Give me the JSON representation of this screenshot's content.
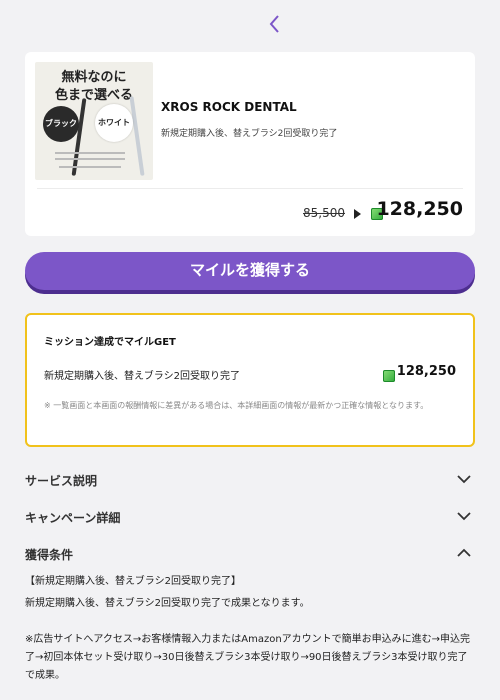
{
  "header": {
    "back_icon": "chevron-left-icon"
  },
  "offer": {
    "thumbnail": {
      "line1": "無料なのに",
      "line2": "色まで選べる",
      "black_label": "ブラック",
      "white_label": "ホワイト"
    },
    "title": "XROS ROCK DENTAL",
    "description": "新規定期購入後、替えブラシ2回受取り完了",
    "old_points": "85,500",
    "points": "128,250"
  },
  "cta": {
    "label": "マイルを獲得する"
  },
  "mission": {
    "title": "ミッション達成でマイルGET",
    "description": "新規定期購入後、替えブラシ2回受取り完了",
    "points": "128,250",
    "note": "※ 一覧画面と本画面の報酬情報に差異がある場合は、本詳細画面の情報が最新かつ正確な情報となります。"
  },
  "sections": [
    {
      "label": "サービス説明",
      "expanded": false
    },
    {
      "label": "キャンペーン詳細",
      "expanded": false
    },
    {
      "label": "獲得条件",
      "expanded": true
    }
  ],
  "conditions": {
    "heading": "【新規定期購入後、替えブラシ2回受取り完了】",
    "line1": "新規定期購入後、替えブラシ2回受取り完了で成果となります。",
    "line2": "※広告サイトへアクセス→お客様情報入力またはAmazonアカウントで簡単お申込みに進む→申込完了→初回本体セット受け取り→30日後替えブラシ3本受け取り→90日後替えブラシ3本受け取り完了で成果。"
  },
  "colors": {
    "accent": "#7c56c8",
    "highlight_border": "#f1c21b",
    "gem": "#2eaa3a"
  }
}
